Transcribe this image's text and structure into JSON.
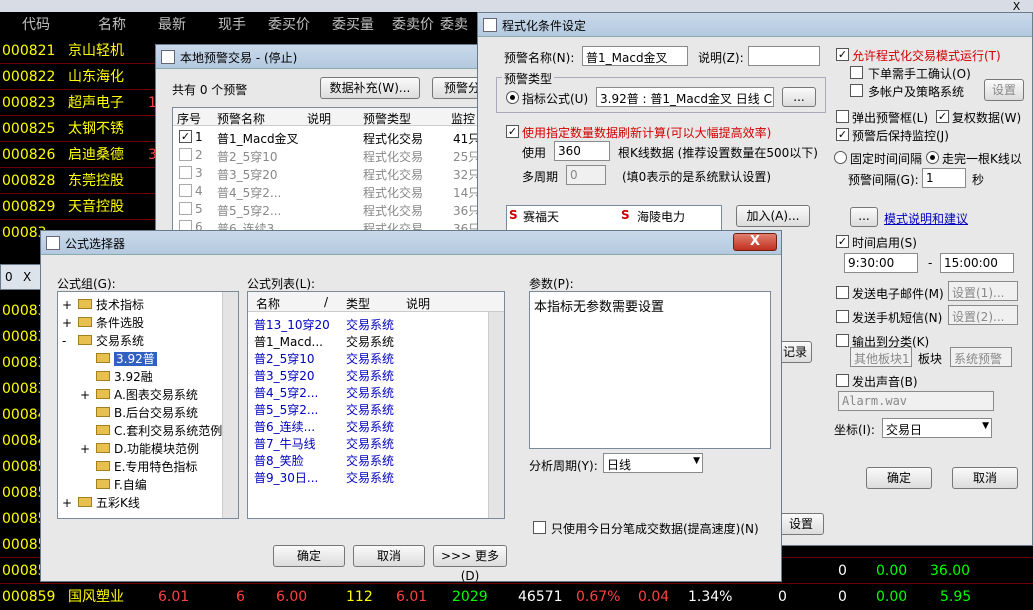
{
  "stock_table": {
    "headers": {
      "code": "代码",
      "name": "名称",
      "latest": "最新",
      "now_vol": "现手",
      "bid": "委买价",
      "bid_vol": "委买量",
      "ask": "委卖价",
      "ask_vol": "委卖量"
    },
    "rows": [
      {
        "code": "000821",
        "name": "京山轻机"
      },
      {
        "code": "000822",
        "name": "山东海化"
      },
      {
        "code": "000823",
        "name": "超声电子"
      },
      {
        "code": "000825",
        "name": "太钢不锈"
      },
      {
        "code": "000826",
        "name": "启迪桑德"
      },
      {
        "code": "000828",
        "name": "东莞控股"
      },
      {
        "code": "000829",
        "name": "天音控股"
      },
      {
        "code": "00083",
        "name": ""
      },
      {
        "code": "00083",
        "name": ""
      },
      {
        "code": "00083",
        "name": ""
      },
      {
        "code": "00083",
        "name": ""
      },
      {
        "code": "00083",
        "name": ""
      },
      {
        "code": "00084",
        "name": ""
      },
      {
        "code": "00084",
        "name": ""
      },
      {
        "code": "00085",
        "name": ""
      },
      {
        "code": "00085",
        "name": ""
      },
      {
        "code": "00085",
        "name": ""
      },
      {
        "code": "00085",
        "name": ""
      },
      {
        "code": "00085",
        "name": ""
      },
      {
        "code": "00085",
        "name": ""
      },
      {
        "code": "00085",
        "name": ""
      },
      {
        "code": "00085",
        "name": ""
      }
    ],
    "last_row": {
      "code": "000859",
      "name": "国风塑业",
      "latest": "6.01",
      "now": "6",
      "bid": "6.00",
      "bid_vol": "112",
      "ask": "6.01",
      "ask_vol": "2029",
      "vol": "46571",
      "pct": "0.67%",
      "rate": "0.04",
      "turnover": "1.34%",
      "c1": "0",
      "c2": "0.00",
      "c3": "5.95"
    },
    "row_858_tail": {
      "c1": "0",
      "c2": "0.00",
      "c3": "36.00"
    },
    "row_826_partial": "3",
    "row_823_partial": "1"
  },
  "alert_window": {
    "title": "本地预警交易 - (停止)",
    "count_text": "共有 0 个预警",
    "btn_supplement": "数据补充(W)...",
    "btn_alert_partial": "预警分",
    "columns": [
      "序号",
      "预警名称",
      "说明",
      "预警类型",
      "监控"
    ],
    "rows": [
      {
        "no": "1",
        "name": "普1_Macd金叉",
        "type": "程式化交易",
        "mon": "41只",
        "checked": true
      },
      {
        "no": "2",
        "name": "普2_5穿10",
        "type": "程式化交易",
        "mon": "25只",
        "checked": false
      },
      {
        "no": "3",
        "name": "普3_5穿20",
        "type": "程式化交易",
        "mon": "32只",
        "checked": false
      },
      {
        "no": "4",
        "name": "普4_5穿2...",
        "type": "程式化交易",
        "mon": "14只",
        "checked": false
      },
      {
        "no": "5",
        "name": "普5_5穿2...",
        "type": "程式化交易",
        "mon": "36只",
        "checked": false
      },
      {
        "no": "6",
        "name": "普6_连续3...",
        "type": "程式化交易",
        "mon": "36只",
        "checked": false
      }
    ]
  },
  "cond_window": {
    "title": "程式化条件设定",
    "alert_name_label": "预警名称(N):",
    "alert_name_value": "普1_Macd金叉",
    "desc_label": "说明(Z):",
    "type_group": "预警类型",
    "formula_label": "指标公式(U)",
    "formula_value": "3.92普 : 普1_Macd金叉 日线 C",
    "browse_btn": "...",
    "use_data_label": "使用指定数量数据刷新计算(可以大幅提高效率)",
    "use_label": "使用",
    "use_value": "360",
    "kline_hint": "根K线数据 (推荐设置数量在500以下)",
    "multi_period_label": "多周期",
    "multi_period_value": "0",
    "multi_hint": "(填0表示的是系统默认设置)",
    "stock_list": [
      {
        "s": "S",
        "name": "赛福天"
      },
      {
        "s": "S",
        "name": "海陵电力"
      }
    ],
    "add_btn": "加入(A)...",
    "record_partial": "记录",
    "settings_partial": "设置",
    "allow_label": "允许程式化交易模式运行(T)",
    "manual_confirm": "下单需手工确认(O)",
    "multi_account": "多帐户及策略系统",
    "settings_btn": "设置",
    "popup_label": "弹出预警框(L)",
    "review_label": "复权数据(W)",
    "keep_monitor": "预警后保持监控(J)",
    "fixed_interval": "固定时间间隔",
    "after_kline": "走完一根K线以",
    "interval_label": "预警间隔(G):",
    "interval_value": "1",
    "seconds": "秒",
    "mode_btn": "...",
    "mode_link": "模式说明和建议",
    "time_enable": "时间启用(S)",
    "start_time": "9:30:00",
    "end_time": "15:00:00",
    "dash": "-",
    "send_email": "发送电子邮件(M)",
    "email_setup": "设置(1)...",
    "send_sms": "发送手机短信(N)",
    "sms_setup": "设置(2)...",
    "output_cat": "输出到分类(K)",
    "other_block": "其他板块1",
    "block_label": "板块",
    "system_alert": "系统预警",
    "play_sound": "发出声音(B)",
    "sound_file": "Alarm.wav",
    "coord_label": "坐标(I):",
    "coord_value": "交易日",
    "ok_btn": "确定",
    "cancel_btn": "取消"
  },
  "formula_window": {
    "title": "公式选择器",
    "group_label": "公式组(G):",
    "tree": [
      {
        "label": "技术指标",
        "level": 0,
        "exp": "+"
      },
      {
        "label": "条件选股",
        "level": 0,
        "exp": "+"
      },
      {
        "label": "交易系统",
        "level": 0,
        "exp": "-"
      },
      {
        "label": "3.92普",
        "level": 1,
        "exp": "",
        "sel": true
      },
      {
        "label": "3.92融",
        "level": 1,
        "exp": ""
      },
      {
        "label": "A.图表交易系统",
        "level": 1,
        "exp": "+"
      },
      {
        "label": "B.后台交易系统",
        "level": 1,
        "exp": ""
      },
      {
        "label": "C.套利交易系统范例",
        "level": 1,
        "exp": ""
      },
      {
        "label": "D.功能模块范例",
        "level": 1,
        "exp": "+"
      },
      {
        "label": "E.专用特色指标",
        "level": 1,
        "exp": ""
      },
      {
        "label": "F.自编",
        "level": 1,
        "exp": ""
      },
      {
        "label": "五彩K线",
        "level": 0,
        "exp": "+"
      }
    ],
    "list_label": "公式列表(L):",
    "list_cols": [
      "名称",
      "/",
      "类型",
      "说明"
    ],
    "list": [
      {
        "name": "普13_10穿20",
        "type": "交易系统"
      },
      {
        "name": "普1_Macd...",
        "type": "交易系统"
      },
      {
        "name": "普2_5穿10",
        "type": "交易系统"
      },
      {
        "name": "普3_5穿20",
        "type": "交易系统"
      },
      {
        "name": "普4_5穿2...",
        "type": "交易系统"
      },
      {
        "name": "普5_5穿2...",
        "type": "交易系统"
      },
      {
        "name": "普6_连续...",
        "type": "交易系统"
      },
      {
        "name": "普7_牛马线",
        "type": "交易系统"
      },
      {
        "name": "普8_笑脸",
        "type": "交易系统"
      },
      {
        "name": "普9_30日...",
        "type": "交易系统"
      }
    ],
    "params_label": "参数(P):",
    "params_text": "本指标无参数需要设置",
    "period_label": "分析周期(Y):",
    "period_value": "日线",
    "only_today": "只使用今日分笔成交数据(提高速度)(N)",
    "ok_btn": "确定",
    "cancel_btn": "取消",
    "more_btn": ">>> 更多(D)",
    "close": "X"
  },
  "misc": {
    "top_close": "X",
    "left_stub": "0",
    "x_stub": "X"
  }
}
